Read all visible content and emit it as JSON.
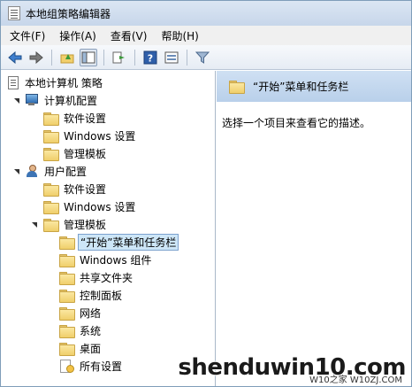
{
  "window": {
    "title": "本地组策略编辑器"
  },
  "menu": [
    "文件(F)",
    "操作(A)",
    "查看(V)",
    "帮助(H)"
  ],
  "toolbar": {
    "buttons": [
      "back-icon",
      "forward-icon",
      "up-folder-icon",
      "show-hide-tree-icon",
      "export-list-icon",
      "help-icon",
      "properties-icon",
      "filter-icon"
    ]
  },
  "tree": {
    "root": "本地计算机 策略",
    "computer_config": "计算机配置",
    "cc_software": "软件设置",
    "cc_windows": "Windows 设置",
    "cc_admin": "管理模板",
    "user_config": "用户配置",
    "uc_software": "软件设置",
    "uc_windows": "Windows 设置",
    "uc_admin": "管理模板",
    "start_menu": "“开始”菜单和任务栏",
    "windows_components": "Windows 组件",
    "shared_folders": "共享文件夹",
    "control_panel": "控制面板",
    "network": "网络",
    "system": "系统",
    "desktop": "桌面",
    "all_settings": "所有设置"
  },
  "detail": {
    "header": "“开始”菜单和任务栏",
    "description": "选择一个项目来查看它的描述。"
  },
  "watermark": {
    "main": "shenduwin10.com",
    "sub": "W10之家 W10ZJ.COM"
  }
}
